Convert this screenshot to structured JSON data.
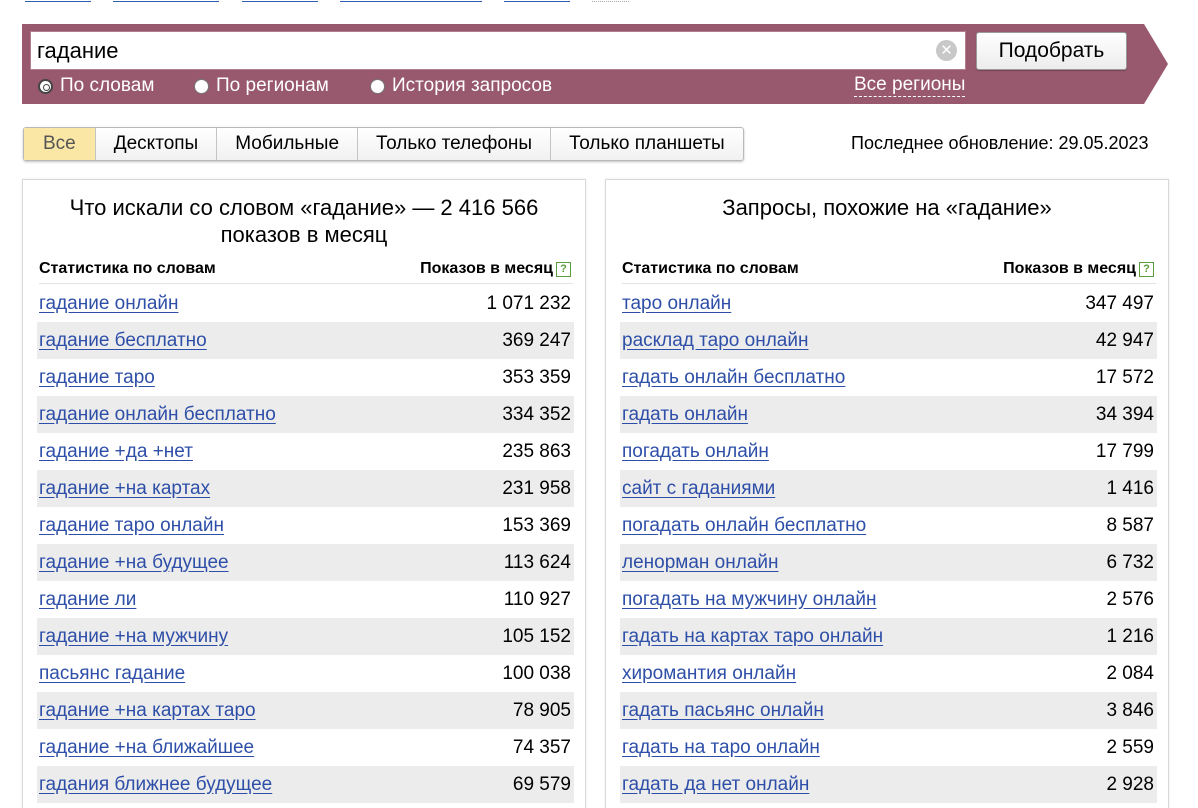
{
  "search": {
    "query": "гадание",
    "submit_label": "Подобрать",
    "clear_icon": "close-icon",
    "modes": [
      {
        "label": "По словам",
        "checked": true
      },
      {
        "label": "По регионам",
        "checked": false
      },
      {
        "label": "История запросов",
        "checked": false
      }
    ],
    "regions_label": "Все регионы"
  },
  "devices": {
    "tabs": [
      {
        "label": "Все",
        "active": true
      },
      {
        "label": "Десктопы",
        "active": false
      },
      {
        "label": "Мобильные",
        "active": false
      },
      {
        "label": "Только телефоны",
        "active": false
      },
      {
        "label": "Только планшеты",
        "active": false
      }
    ],
    "last_update": "Последнее обновление: 29.05.2023"
  },
  "left_panel": {
    "title_line1": "Что искали со словом «гадание» — 2 416 566",
    "title_line2": "показов в месяц",
    "col_words": "Статистика по словам",
    "col_count": "Показов в месяц",
    "help_label": "?",
    "rows": [
      {
        "phrase": "гадание онлайн",
        "count": "1 071 232"
      },
      {
        "phrase": "гадание бесплатно",
        "count": "369 247"
      },
      {
        "phrase": "гадание таро",
        "count": "353 359"
      },
      {
        "phrase": "гадание онлайн бесплатно",
        "count": "334 352"
      },
      {
        "phrase": "гадание +да +нет",
        "count": "235 863"
      },
      {
        "phrase": "гадание +на картах",
        "count": "231 958"
      },
      {
        "phrase": "гадание таро онлайн",
        "count": "153 369"
      },
      {
        "phrase": "гадание +на будущее",
        "count": "113 624"
      },
      {
        "phrase": "гадание ли",
        "count": "110 927"
      },
      {
        "phrase": "гадание +на мужчину",
        "count": "105 152"
      },
      {
        "phrase": "пасьянс гадание",
        "count": "100 038"
      },
      {
        "phrase": "гадание +на картах таро",
        "count": "78 905"
      },
      {
        "phrase": "гадание +на ближайшее",
        "count": "74 357"
      },
      {
        "phrase": "гадания ближнее будущее",
        "count": "69 579"
      }
    ]
  },
  "right_panel": {
    "title": "Запросы, похожие на «гадание»",
    "col_words": "Статистика по словам",
    "col_count": "Показов в месяц",
    "help_label": "?",
    "rows": [
      {
        "phrase": "таро онлайн",
        "count": "347 497"
      },
      {
        "phrase": "расклад таро онлайн",
        "count": "42 947"
      },
      {
        "phrase": "гадать онлайн бесплатно",
        "count": "17 572"
      },
      {
        "phrase": "гадать онлайн",
        "count": "34 394"
      },
      {
        "phrase": "погадать онлайн",
        "count": "17 799"
      },
      {
        "phrase": "сайт с гаданиями",
        "count": "1 416"
      },
      {
        "phrase": "погадать онлайн бесплатно",
        "count": "8 587"
      },
      {
        "phrase": "ленорман онлайн",
        "count": "6 732"
      },
      {
        "phrase": "погадать на мужчину онлайн",
        "count": "2 576"
      },
      {
        "phrase": "гадать на картах таро онлайн",
        "count": "1 216"
      },
      {
        "phrase": "хиромантия онлайн",
        "count": "2 084"
      },
      {
        "phrase": "гадать пасьянс онлайн",
        "count": "3 846"
      },
      {
        "phrase": "гадать на таро онлайн",
        "count": "2 559"
      },
      {
        "phrase": "гадать да нет онлайн",
        "count": "2 928"
      }
    ]
  },
  "colors": {
    "band": "#98596f",
    "link": "#2e4fa8",
    "active_tab": "#fbe7a5",
    "row_stripe": "#ececec"
  }
}
